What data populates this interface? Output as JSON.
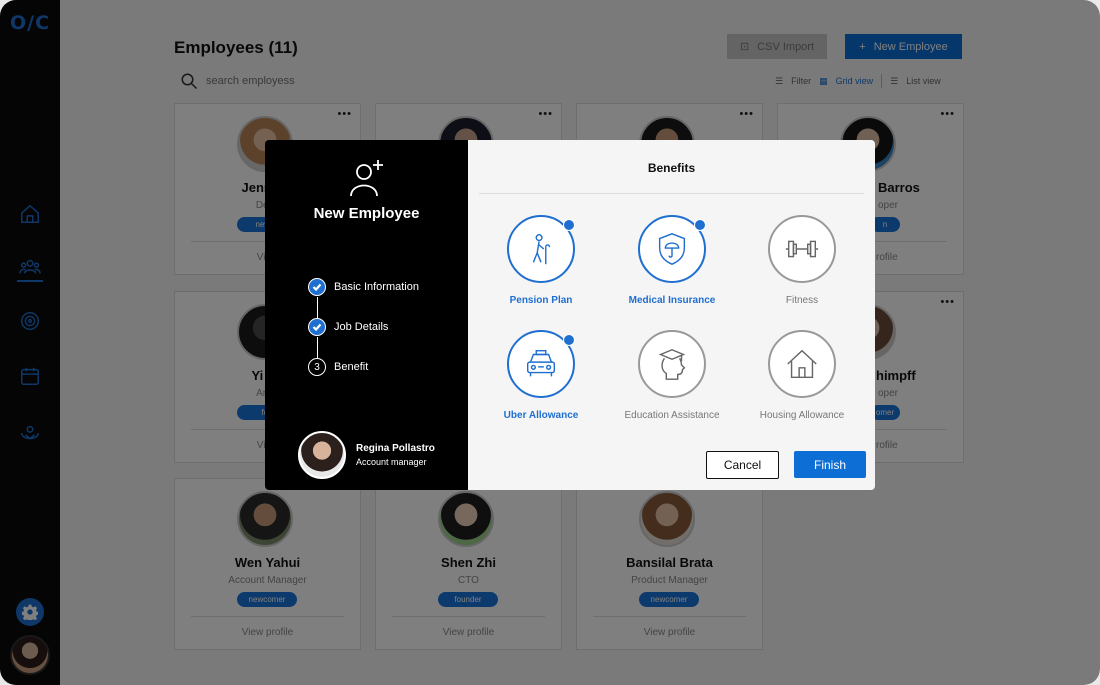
{
  "app": {
    "logo": "O/C"
  },
  "header": {
    "title": "Employees (11)",
    "search_placeholder": "search employess",
    "csv_button": "CSV Import",
    "new_button": "New Employee",
    "filter_label": "Filter",
    "grid_view": "Grid view",
    "list_view": "List view"
  },
  "cards": [
    {
      "name": "Jenny M",
      "role": "Deve",
      "badge": "newco",
      "view": "View"
    },
    {
      "name": "Barros",
      "role": "oper",
      "badge": "n",
      "view": "rofile"
    },
    {
      "name": "Yi Ha",
      "role": "Art D",
      "badge": "fou",
      "view": "View"
    },
    {
      "name": "himpff",
      "role": "oper",
      "badge": "omer",
      "view": "rofile"
    },
    {
      "name": "Wen Yahui",
      "role": "Account Manager",
      "badge": "newcomer",
      "view": "View profile"
    },
    {
      "name": "Shen Zhi",
      "role": "CTO",
      "badge": "founder",
      "view": "View profile"
    },
    {
      "name": "Bansilal Brata",
      "role": "Product Manager",
      "badge": "newcomer",
      "view": "View profile"
    }
  ],
  "modal": {
    "title": "New Employee",
    "steps": [
      {
        "label": "Basic Information",
        "state": "done"
      },
      {
        "label": "Job Details",
        "state": "done"
      },
      {
        "label": "Benefit",
        "state": "current",
        "number": "3"
      }
    ],
    "manager": {
      "name": "Regina Pollastro",
      "role": "Account manager"
    },
    "heading": "Benefits",
    "benefits": [
      {
        "label": "Pension Plan",
        "selected": true,
        "icon": "elderly-icon"
      },
      {
        "label": "Medical Insurance",
        "selected": true,
        "icon": "umbrella-shield-icon"
      },
      {
        "label": "Fitness",
        "selected": false,
        "icon": "dumbbell-icon"
      },
      {
        "label": "Uber Allowance",
        "selected": true,
        "icon": "taxi-icon"
      },
      {
        "label": "Education Assistance",
        "selected": false,
        "icon": "graduate-head-icon"
      },
      {
        "label": "Housing Allowance",
        "selected": false,
        "icon": "house-icon"
      }
    ],
    "cancel_label": "Cancel",
    "finish_label": "Finish"
  },
  "colors": {
    "accent": "#0d6fd6",
    "sidebar": "#0b0b0b"
  }
}
